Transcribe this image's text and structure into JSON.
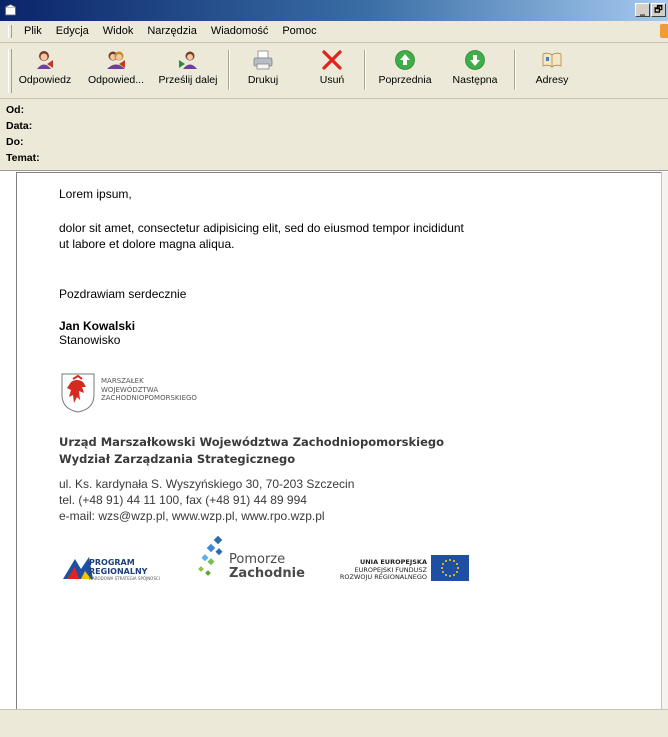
{
  "menu": [
    "Plik",
    "Edycja",
    "Widok",
    "Narzędzia",
    "Wiadomość",
    "Pomoc"
  ],
  "window_buttons": [
    "_",
    "🗗"
  ],
  "toolbar": [
    {
      "label": "Odpowiedz",
      "icon": "reply-icon"
    },
    {
      "label": "Odpowied...",
      "icon": "reply-all-icon"
    },
    {
      "label": "Prześlij dalej",
      "icon": "forward-icon"
    },
    {
      "label": "Drukuj",
      "icon": "print-icon"
    },
    {
      "label": "Usuń",
      "icon": "delete-icon"
    },
    {
      "label": "Poprzednia",
      "icon": "previous-icon"
    },
    {
      "label": "Następna",
      "icon": "next-icon"
    },
    {
      "label": "Adresy",
      "icon": "address-book-icon"
    }
  ],
  "headers": {
    "from": "Od:",
    "date": "Data:",
    "to": "Do:",
    "subject": "Temat:"
  },
  "body": {
    "greeting": "Lorem ipsum,",
    "line1": "dolor sit amet, consectetur adipisicing elit, sed do eiusmod tempor incididunt",
    "line2": "ut labore et dolore magna aliqua.",
    "closing": "Pozdrawiam serdecznie",
    "name": "Jan Kowalski",
    "position": "Stanowisko"
  },
  "signature": {
    "crest_lines": [
      "MARSZAŁEK",
      "WOJEWÓDZTWA",
      "ZACHODNIOPOMORSKIEGO"
    ],
    "org1": "Urząd Marszałkowski Województwa Zachodniopomorskiego",
    "org2": "Wydział Zarządzania Strategicznego",
    "addr1": "ul. Ks. kardynała S. Wyszyńskiego 30, 70-203 Szczecin",
    "addr2": "tel. (+48 91) 44 11 100, fax (+48 91) 44 89 994",
    "addr3": "e-mail: wzs@wzp.pl, www.wzp.pl, www.rpo.wzp.pl"
  },
  "logos": {
    "program": [
      "PROGRAM",
      "REGIONALNY",
      "NARODOWA STRATEGIA SPÓJNOŚCI"
    ],
    "pomorze": [
      "Pomorze",
      "Zachodnie"
    ],
    "eu": [
      "UNIA EUROPEJSKA",
      "EUROPEJSKI FUNDUSZ",
      "ROZWOJU REGIONALNEGO"
    ]
  },
  "colors": {
    "titlebar": "#0a246a",
    "chrome": "#ece9d8",
    "eu_blue": "#1f4fa3",
    "eu_star": "#ffd400",
    "pomorze_blue": "#2b6cb0"
  }
}
